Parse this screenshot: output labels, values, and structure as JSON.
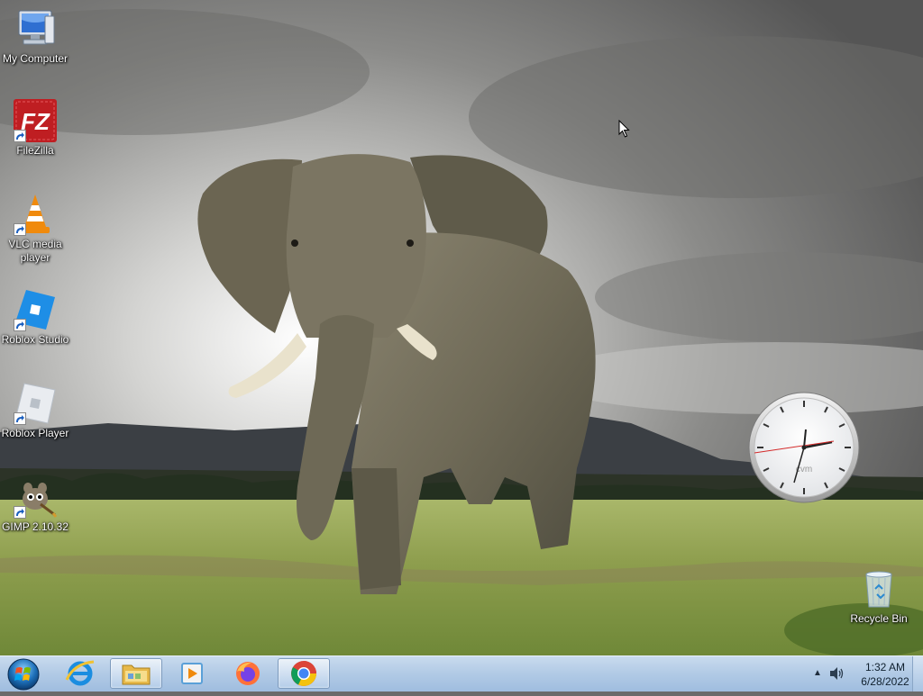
{
  "desktop": {
    "icons": [
      {
        "label": "My Computer",
        "icon": "computer-icon"
      },
      {
        "label": "FileZilla",
        "icon": "filezilla-icon"
      },
      {
        "label": "VLC media player",
        "icon": "vlc-icon"
      },
      {
        "label": "Roblox Studio",
        "icon": "roblox-studio-icon"
      },
      {
        "label": "Roblox Player",
        "icon": "roblox-player-icon"
      },
      {
        "label": "GIMP 2.10.32",
        "icon": "gimp-icon"
      },
      {
        "label": "Recycle Bin",
        "icon": "recycle-bin-icon"
      }
    ],
    "clock_gadget_label": "cvm"
  },
  "taskbar": {
    "start_button": "start-orb-icon",
    "pinned": [
      {
        "name": "Internet Explorer",
        "icon": "internet-explorer-icon",
        "active": false
      },
      {
        "name": "Windows Explorer",
        "icon": "folder-explorer-icon",
        "active": true
      },
      {
        "name": "Windows Media Player",
        "icon": "media-player-icon",
        "active": false
      },
      {
        "name": "Firefox",
        "icon": "firefox-icon",
        "active": false
      },
      {
        "name": "Google Chrome",
        "icon": "chrome-icon",
        "active": true
      }
    ],
    "tray": {
      "time": "1:32 AM",
      "date": "6/28/2022"
    }
  },
  "colors": {
    "taskbar": "#b3cbe6",
    "filezilla_red": "#bf1e22",
    "vlc_orange": "#f08a0c",
    "roblox_blue": "#1e8ee6",
    "chrome_red": "#db4437",
    "chrome_yellow": "#f4c20d",
    "chrome_green": "#0f9d58",
    "chrome_blue": "#4285f4"
  }
}
